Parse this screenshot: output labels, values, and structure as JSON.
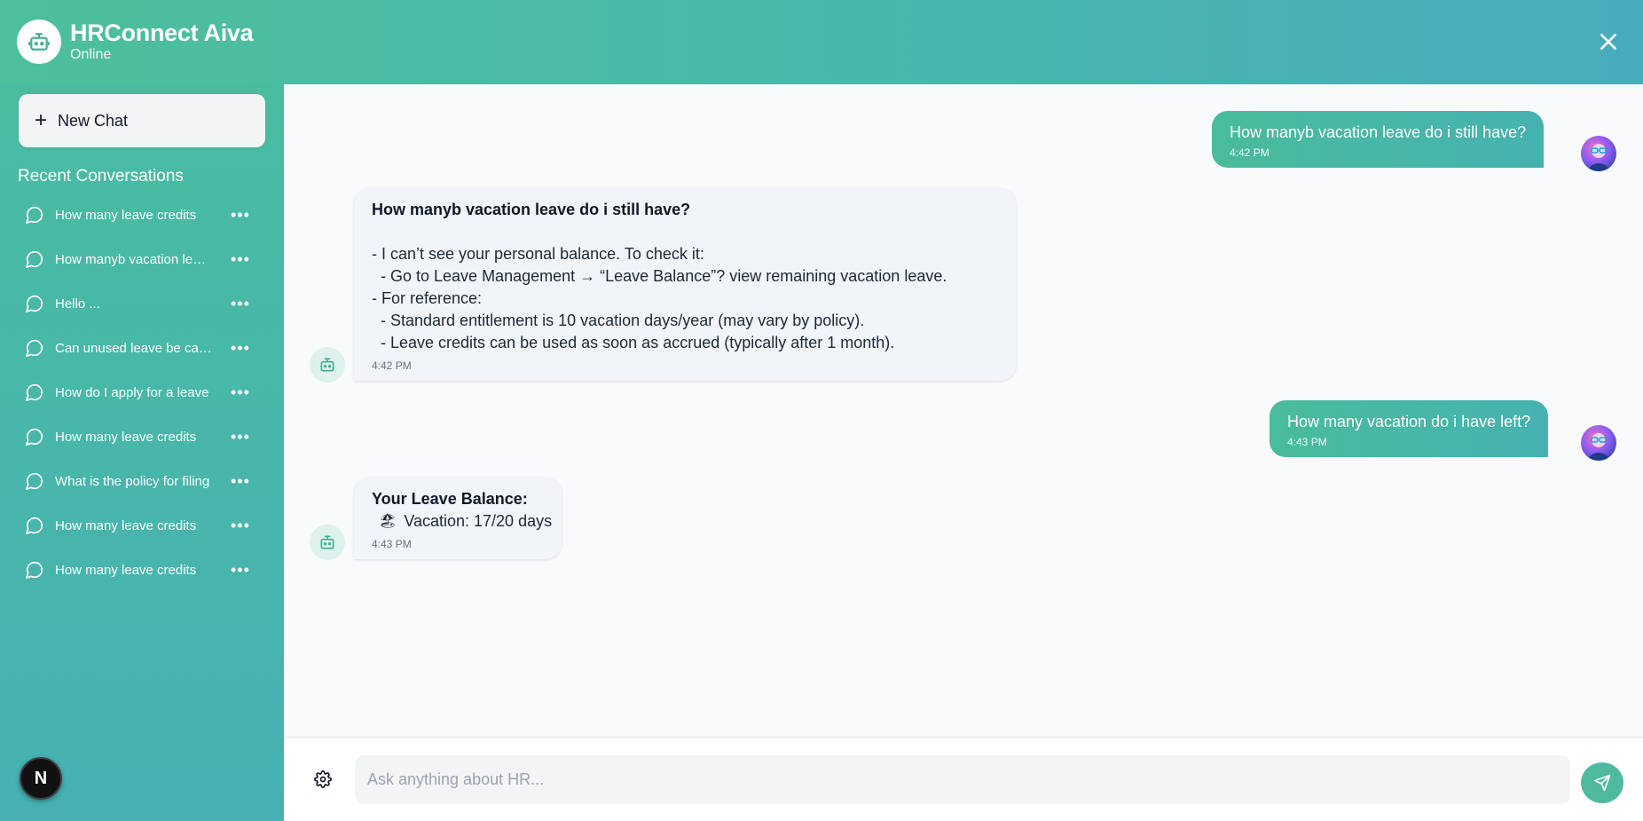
{
  "header": {
    "title": "HRConnect Aiva",
    "status": "Online",
    "brand_icon": "robot-icon",
    "close_icon": "close-icon"
  },
  "sidebar": {
    "new_chat_label": "New Chat",
    "recent_heading": "Recent Conversations",
    "conversations": [
      {
        "label": "How many leave credits"
      },
      {
        "label": "How manyb vacation leave"
      },
      {
        "label": "Hello ..."
      },
      {
        "label": "Can unused leave be carried"
      },
      {
        "label": "How do I apply for a leave"
      },
      {
        "label": "How many leave credits"
      },
      {
        "label": "What is the policy for filing"
      },
      {
        "label": "How many leave credits"
      },
      {
        "label": "How many leave credits"
      }
    ],
    "more_label": "•••",
    "badge_letter": "N"
  },
  "messages": [
    {
      "role": "user",
      "text": "How manyb vacation leave do i still have?",
      "time": "4:42 PM"
    },
    {
      "role": "bot",
      "heading": "How manyb vacation leave do i still have?",
      "lines": [
        "- I can’t see your personal balance. To check it:",
        "  - Go to Leave Management → “Leave Balance”? view remaining vacation leave.",
        "- For reference:",
        "  - Standard entitlement is 10 vacation days/year (may vary by policy).",
        "  - Leave credits can be used as soon as accrued (typically after 1 month)."
      ],
      "time": "4:42 PM"
    },
    {
      "role": "user",
      "text": "How many vacation do i have left?",
      "time": "4:43 PM"
    },
    {
      "role": "bot",
      "heading": "Your Leave Balance:",
      "lines": [
        "Vacation: 17/20 days"
      ],
      "emoji": "🏖",
      "time": "4:43 PM"
    }
  ],
  "composer": {
    "placeholder": "Ask anything about HR...",
    "settings_icon": "gear-icon",
    "send_icon": "send-icon"
  },
  "colors": {
    "accent": "#4dbf9c",
    "accent_alt": "#49acbd",
    "bot_bubble": "#f1f4f8"
  }
}
